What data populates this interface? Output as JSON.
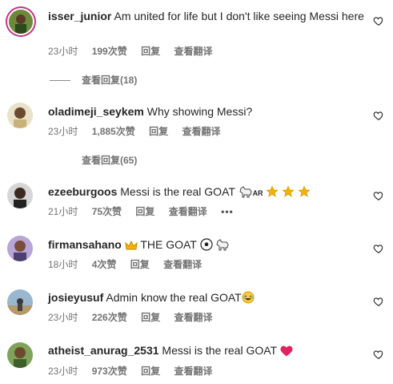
{
  "comments": [
    {
      "username": "isser_junior",
      "text": "Am united for life but I don't like seeing Messi here",
      "time": "23小时",
      "likes": "199次赞",
      "reply": "回复",
      "translate": "查看翻译",
      "view_replies": "查看回复(18)"
    },
    {
      "username": "oladimeji_seykem",
      "text": "Why showing Messi?",
      "time": "23小时",
      "likes": "1,885次赞",
      "reply": "回复",
      "translate": "查看翻译",
      "view_replies": "查看回复(65)"
    },
    {
      "username": "ezeeburgoos",
      "text": "Messi is the real GOAT",
      "text_suffix": "AR",
      "time": "21小时",
      "likes": "75次赞",
      "reply": "回复",
      "translate": "查看翻译",
      "more": "•••"
    },
    {
      "username": "firmansahano",
      "text": "THE GOAT",
      "time": "18小时",
      "likes": "4次赞",
      "reply": "回复",
      "translate": "查看翻译"
    },
    {
      "username": "josieyusuf",
      "text": "Admin know the real GOAT",
      "time": "23小时",
      "likes": "226次赞",
      "reply": "回复",
      "translate": "查看翻译"
    },
    {
      "username": "atheist_anurag_2531",
      "text": "Messi is the real GOAT",
      "time": "23小时",
      "likes": "973次赞",
      "reply": "回复",
      "translate": "查看翻译"
    }
  ],
  "icons": {
    "like": "heart-outline-icon",
    "goat": "goat-emoji",
    "star": "star-emoji",
    "crown": "crown-emoji",
    "ball": "soccer-ball-emoji",
    "laugh": "laughing-face-emoji",
    "heart": "red-heart-emoji"
  },
  "colors": {
    "text": "#262626",
    "secondary": "#737373",
    "story_ring": "#c13584",
    "star": "#f5b301",
    "heart_red": "#e0245e"
  }
}
